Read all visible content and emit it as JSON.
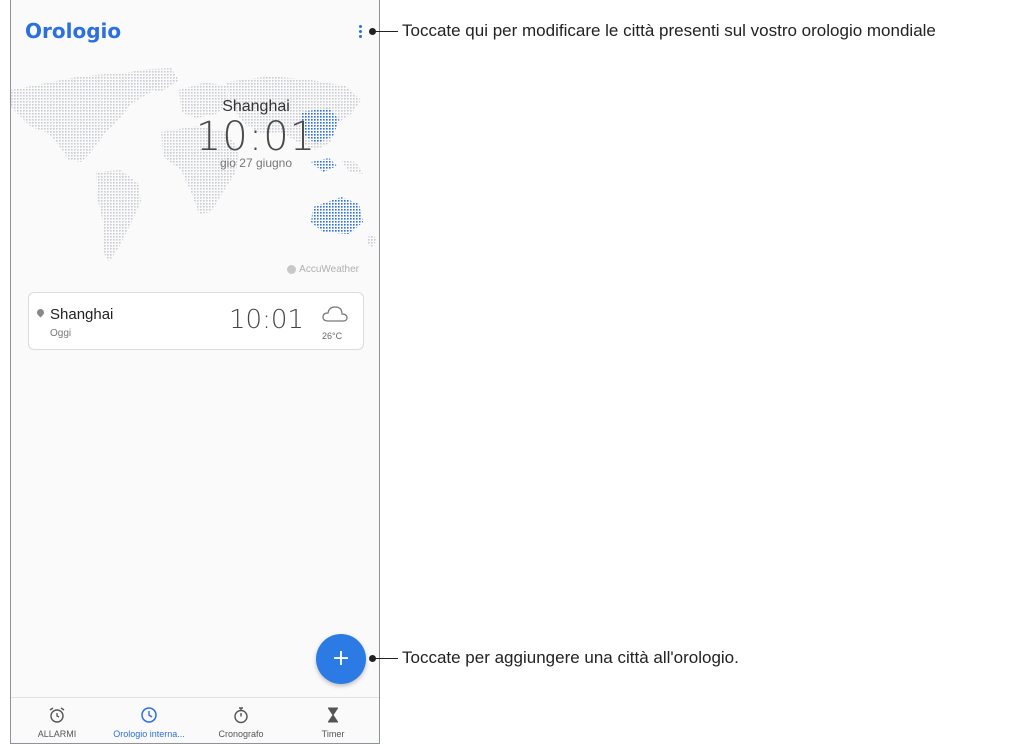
{
  "app": {
    "title": "Orologio"
  },
  "hero": {
    "city": "Shanghai",
    "time": "10:01",
    "date": "gio 27 giugno"
  },
  "attribution": "AccuWeather",
  "cities": [
    {
      "name": "Shanghai",
      "day": "Oggi",
      "time": "10:01",
      "temperature": "26°C",
      "weather_icon": "cloud-icon"
    }
  ],
  "fab": {
    "label": "+"
  },
  "bottom_nav": [
    {
      "label": "ALLARMI",
      "icon": "alarm-icon",
      "active": false
    },
    {
      "label": "Orologio interna...",
      "icon": "clock-icon",
      "active": true
    },
    {
      "label": "Cronografo",
      "icon": "stopwatch-icon",
      "active": false
    },
    {
      "label": "Timer",
      "icon": "hourglass-icon",
      "active": false
    }
  ],
  "callouts": {
    "menu": "Toccate qui per modificare le città presenti sul vostro orologio mondiale",
    "fab": "Toccate per aggiungere una città all'orologio."
  },
  "colors": {
    "accent": "#2c6fe0",
    "fab": "#2c7be5",
    "map_dots": "#c9ccd2",
    "map_highlight": "#2c6fe0"
  }
}
